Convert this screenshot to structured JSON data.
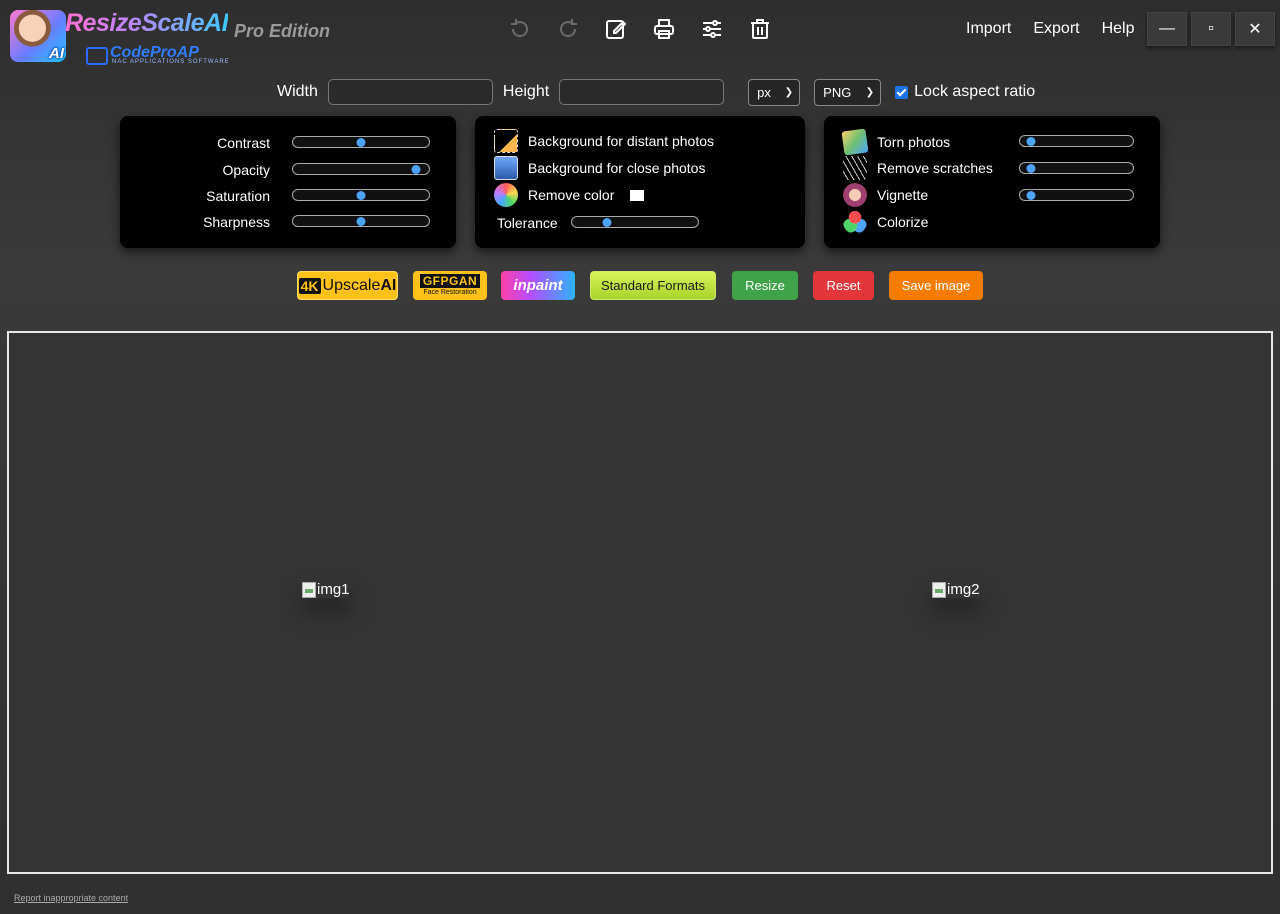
{
  "app": {
    "title": "ResizeScaleAI",
    "edition": "Pro Edition",
    "logo_badge": "AI",
    "company": "CodeProAP",
    "company_sub": "NAC APPLICATIONS SOFTWARE"
  },
  "toolbar": {
    "icons": [
      "rotate-left-icon",
      "rotate-right-icon",
      "edit-icon",
      "print-icon",
      "sliders-icon",
      "trash-icon"
    ]
  },
  "menu": {
    "import": "Import",
    "export": "Export",
    "help": "Help"
  },
  "window": {
    "minimize": "—",
    "maximize": "▫",
    "close": "✕"
  },
  "size": {
    "width_label": "Width",
    "width_value": "",
    "height_label": "Height",
    "height_value": "",
    "unit": "px",
    "format": "PNG",
    "lock_label": "Lock aspect ratio",
    "lock_checked": true
  },
  "adjust_panel": {
    "contrast": {
      "label": "Contrast",
      "value": 0.5
    },
    "opacity": {
      "label": "Opacity",
      "value": 0.94
    },
    "saturation": {
      "label": "Saturation",
      "value": 0.5
    },
    "sharpness": {
      "label": "Sharpness",
      "value": 0.5
    }
  },
  "background_panel": {
    "distant": "Background for distant photos",
    "close": "Background for close photos",
    "remove_color": "Remove color",
    "remove_color_swatch": "#ffffff",
    "tolerance": {
      "label": "Tolerance",
      "value": 0.25
    }
  },
  "restore_panel": {
    "torn": {
      "label": "Torn photos",
      "value": 0.05
    },
    "scratches": {
      "label": "Remove scratches",
      "value": 0.05
    },
    "vignette": {
      "label": "Vignette",
      "value": 0.05
    },
    "colorize": {
      "label": "Colorize"
    }
  },
  "actions": {
    "upscale_tag": "4K",
    "upscale_text": "Upscale",
    "upscale_ai": "AI",
    "gfpgan": "GFPGAN",
    "gfpgan_sub": "Face Restoration",
    "inpaint": "inpaint",
    "standard_formats": "Standard Formats",
    "resize": "Resize",
    "reset": "Reset",
    "save": "Save image"
  },
  "canvas": {
    "img1_alt": "img1",
    "img2_alt": "img2"
  },
  "footer": {
    "report": "Report inappropriate content"
  },
  "colors": {
    "accent": "#4ea3ff",
    "save": "#f57c00",
    "reset": "#e2363b",
    "resize": "#3fa34a",
    "upscale": "#ffc21a"
  }
}
